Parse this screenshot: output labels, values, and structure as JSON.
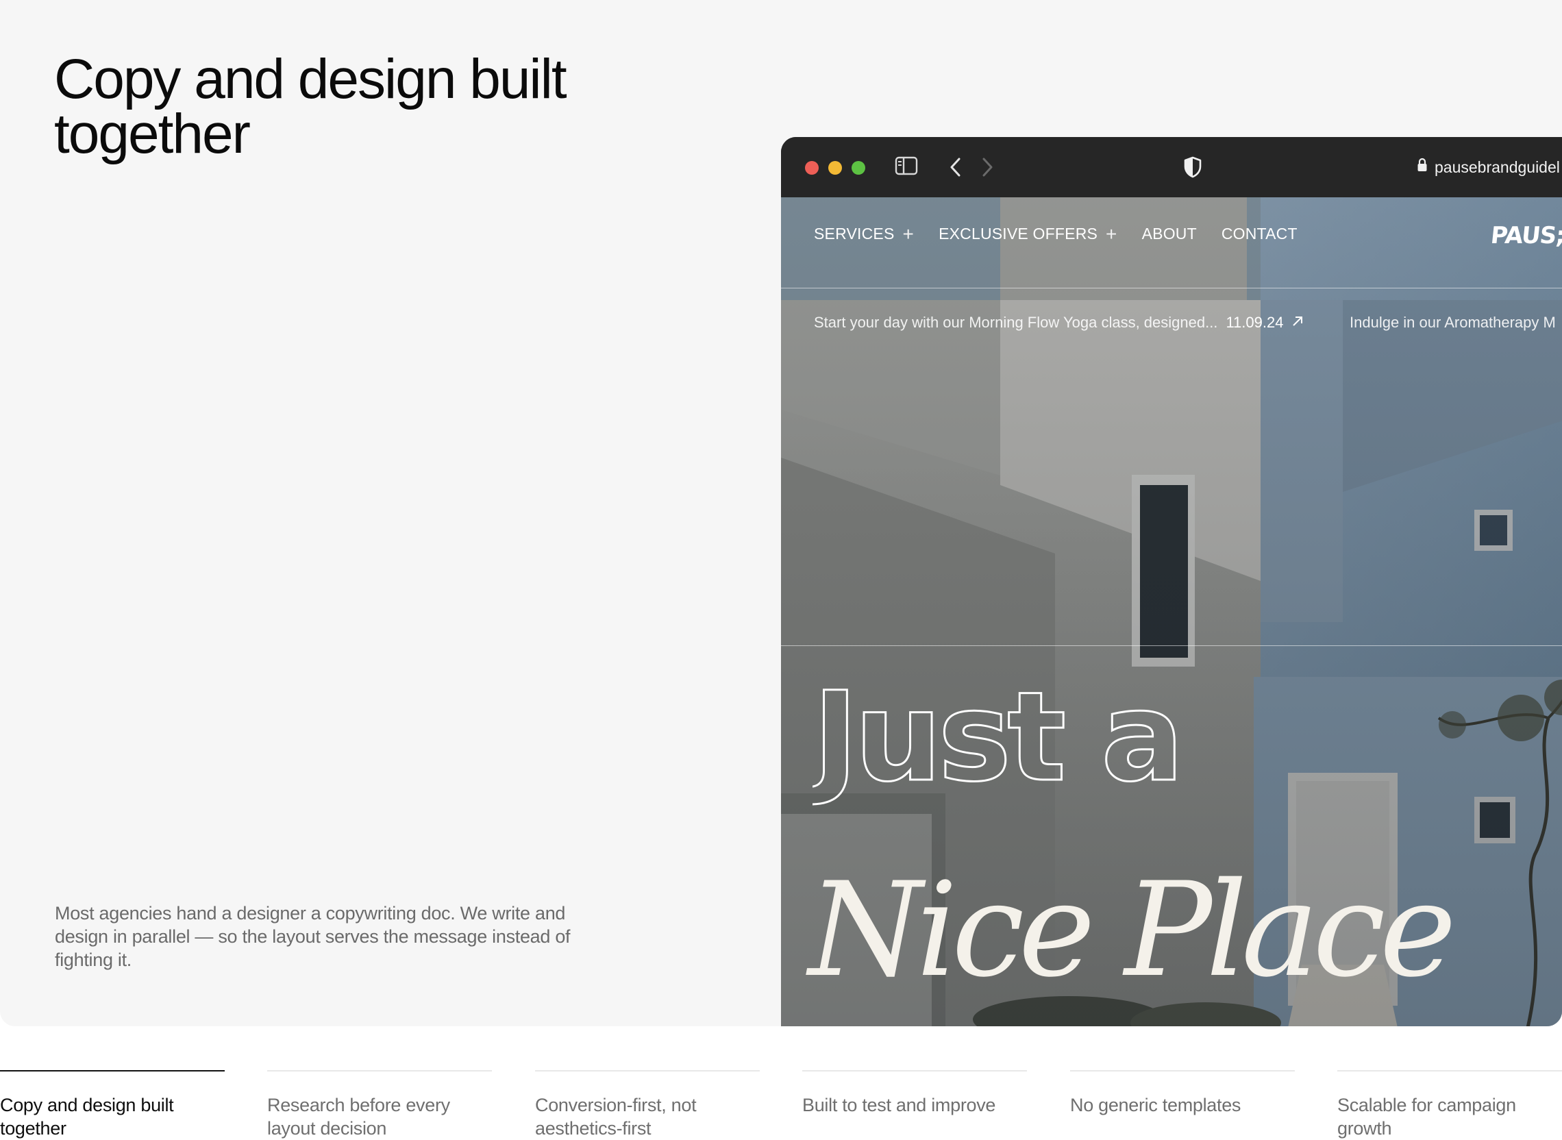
{
  "feature": {
    "title": "Copy and design built together",
    "description": "Most agencies hand a designer a copywriting doc. We write and design in parallel — so the layout serves the message instead of fighting it."
  },
  "browser": {
    "url": "pausebrandguidel",
    "icons": [
      "sidebar-icon",
      "back-icon",
      "forward-icon",
      "shield-icon",
      "lock-icon"
    ]
  },
  "website": {
    "nav": [
      {
        "label": "SERVICES",
        "has_plus": true
      },
      {
        "label": "EXCLUSIVE OFFERS",
        "has_plus": true
      },
      {
        "label": "ABOUT",
        "has_plus": false
      },
      {
        "label": "CONTACT",
        "has_plus": false
      }
    ],
    "logo": "PAUS;",
    "ticker": [
      {
        "text": "Start your day with our Morning Flow Yoga class, designed...",
        "date": "11.09.24"
      },
      {
        "text": "Indulge in our Aromatherapy M"
      }
    ],
    "hero": {
      "line1": "Just a",
      "line2": "Nice Place"
    }
  },
  "tabs": [
    {
      "label": "Copy and design built together",
      "active": true
    },
    {
      "label": "Research before every layout decision",
      "active": false
    },
    {
      "label": "Conversion-first, not aesthetics-first",
      "active": false
    },
    {
      "label": "Built to test and improve",
      "active": false
    },
    {
      "label": "No generic templates",
      "active": false
    },
    {
      "label": "Scalable for campaign growth",
      "active": false
    }
  ],
  "colors": {
    "card_bg": "#f6f6f6",
    "browser_chrome": "#262626",
    "traffic_red": "#ee5f57",
    "traffic_yellow": "#f3b935",
    "traffic_green": "#5dc243",
    "muted_text": "#6a6a6a"
  }
}
